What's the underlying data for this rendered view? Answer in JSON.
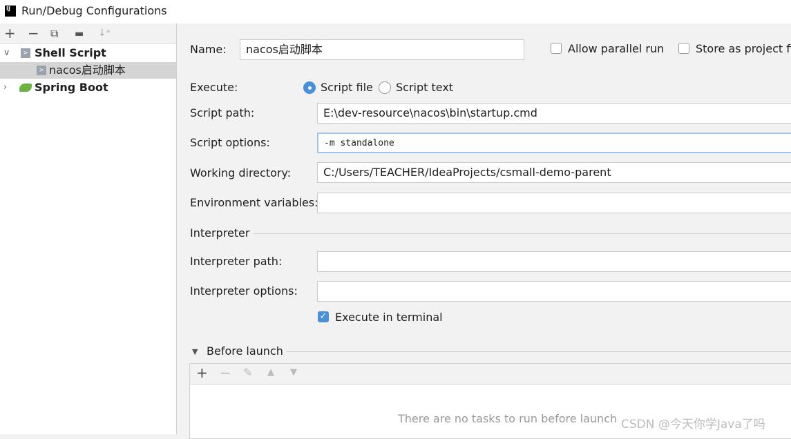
{
  "window": {
    "title": "Run/Debug Configurations",
    "logo": "IJ"
  },
  "toolbar": {
    "add": "+",
    "remove": "−",
    "copy": "⧉",
    "folder": "▬",
    "sort": "↓ᵃ"
  },
  "tree": {
    "items": [
      {
        "label": "Shell Script",
        "expanded": true,
        "icon": "shell-script-icon"
      },
      {
        "label": "nacos启动脚本",
        "selected": true,
        "icon": "shell-script-icon"
      },
      {
        "label": "Spring Boot",
        "expanded": false,
        "icon": "spring-boot-icon"
      }
    ]
  },
  "form": {
    "name_label": "Name:",
    "name_value": "nacos启动脚本",
    "allow_parallel": "Allow parallel run",
    "allow_parallel_checked": false,
    "store_project": "Store as project file",
    "store_project_checked": false,
    "execute_label": "Execute:",
    "script_file": "Script file",
    "script_text": "Script text",
    "execute_selected": "Script file",
    "script_path_label": "Script path:",
    "script_path": "E:\\dev-resource\\nacos\\bin\\startup.cmd",
    "script_options_label": "Script options:",
    "script_options": "-m standalone",
    "working_dir_label": "Working directory:",
    "working_dir": "C:/Users/TEACHER/IdeaProjects/csmall-demo-parent",
    "env_label": "Environment variables:",
    "env_value": "",
    "interpreter_section": "Interpreter",
    "interp_path_label": "Interpreter path:",
    "interp_path": "",
    "interp_options_label": "Interpreter options:",
    "interp_options": "",
    "exec_terminal": "Execute in terminal",
    "exec_terminal_checked": true
  },
  "before_launch": {
    "title": "Before launch",
    "empty": "There are no tasks to run before launch"
  },
  "watermark": "CSDN @今天你学Java了吗",
  "colors": {
    "accent": "#4a90d9",
    "selection": "#d5d5d5"
  }
}
